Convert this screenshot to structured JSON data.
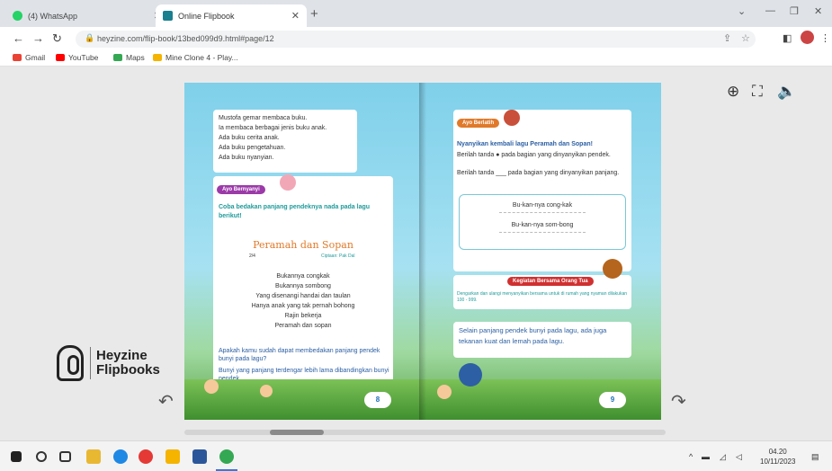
{
  "browser": {
    "tabs": [
      {
        "label": "(4) WhatsApp",
        "active": false
      },
      {
        "label": "Online Flipbook",
        "active": true
      }
    ],
    "url": "heyzine.com/flip-book/13bed099d9.html#page/12",
    "bookmarks": [
      "Gmail",
      "YouTube",
      "Maps",
      "Mine Clone 4 - Play..."
    ]
  },
  "viewer": {
    "logo_line1": "Heyzine",
    "logo_line2": "Flipbooks"
  },
  "left_page": {
    "intro": [
      "Mustofa gemar membaca buku.",
      "Ia membaca berbagai jenis buku anak.",
      "Ada buku cerita anak.",
      "Ada buku pengetahuan.",
      "Ada buku nyanyian."
    ],
    "tag": "Ayo Bernyanyi",
    "instruction": "Coba bedakan panjang pendeknya nada pada lagu berikut!",
    "song_title": "Peramah dan Sopan",
    "song_meta_left": "2/4",
    "song_meta_right": "Ciptaan: Pak Dal",
    "lyrics": [
      "Bukannya congkak",
      "Bukannya sombong",
      "Yang disenangi handai dan taulan",
      "Hanya anak yang tak pernah bohong",
      "Rajin bekerja",
      "Peramah dan sopan"
    ],
    "question": "Apakah kamu sudah dapat membedakan panjang pendek bunyi pada lagu?",
    "note": "Bunyi yang panjang terdengar lebih lama dibandingkan bunyi pendek.",
    "page_number": "8"
  },
  "right_page": {
    "tag": "Ayo Berlatih",
    "instruction": "Nyanyikan kembali lagu Peramah dan Sopan!",
    "hint1": "Berilah tanda ● pada bagian yang dinyanyikan pendek.",
    "hint2": "Berilah tanda ___ pada bagian yang dinyanyikan panjang.",
    "line1": "Bu-kan-nya cong-kak",
    "line2": "Bu-kan-nya som-bong",
    "tag2": "Kegiatan Bersama Orang Tua",
    "parent_note": "Dengarkan dan ulangi menyanyikan bersama untuk di rumah yang nyaman dilakukan 100 - 999.",
    "summary": "Selain panjang pendek bunyi pada lagu, ada juga tekanan kuat dan lemah pada lagu.",
    "page_number": "9"
  },
  "taskbar": {
    "time": "04.20",
    "date": "10/11/2023"
  }
}
